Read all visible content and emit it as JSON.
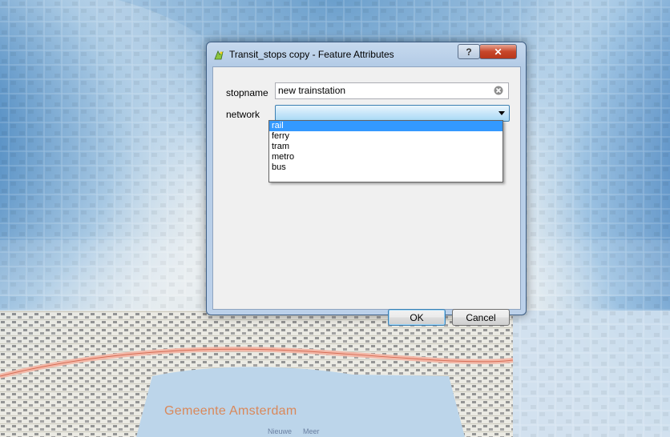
{
  "dialog": {
    "title": "Transit_stops copy - Feature Attributes",
    "help_label": "?",
    "close_label": "✕",
    "fields": {
      "stopname": {
        "label": "stopname",
        "value": "new trainstation"
      },
      "network": {
        "label": "network",
        "value": "",
        "options": [
          "rail",
          "ferry",
          "tram",
          "metro",
          "bus"
        ],
        "highlighted": "rail"
      }
    },
    "ok_label": "OK",
    "cancel_label": "Cancel"
  },
  "map": {
    "place_label": "Gemeente Amsterdam",
    "small_labels": [
      "Nieuwe",
      "Meer"
    ]
  },
  "icons": {
    "app": "qgis-icon",
    "clear": "clear-icon",
    "dropdown": "chevron-down-icon"
  },
  "colors": {
    "dialog_frame": "#b3cbe6",
    "selection": "#3399ff",
    "close_button": "#c7472a",
    "heatmap_dark": "#1f3f73",
    "heatmap_light": "#c9deef"
  }
}
